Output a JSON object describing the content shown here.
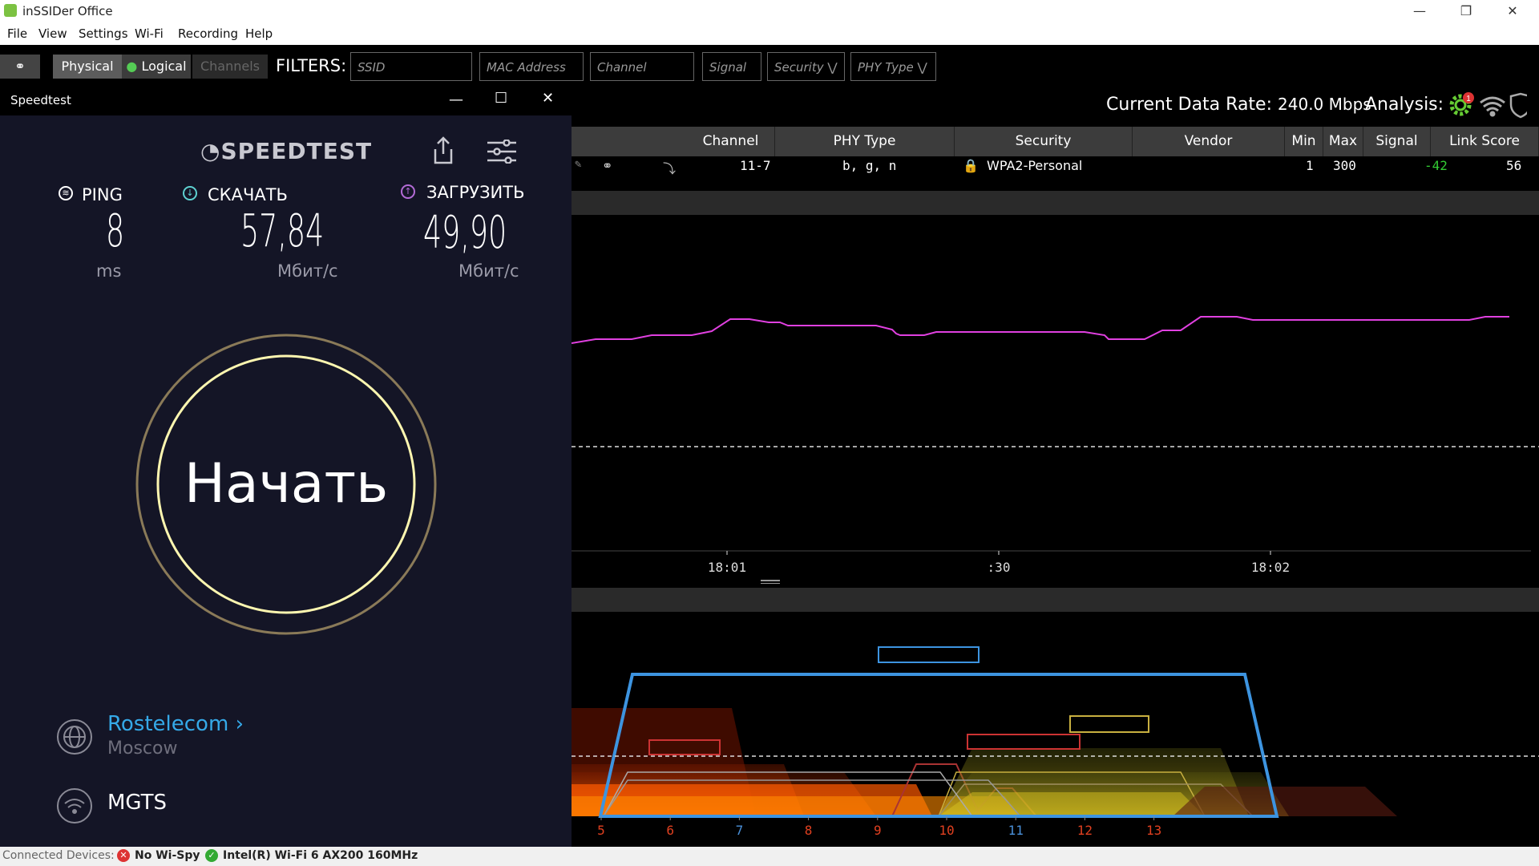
{
  "window": {
    "title": "inSSIDer Office"
  },
  "menu": [
    "File",
    "View",
    "Settings",
    "Wi-Fi",
    "Recording",
    "Help"
  ],
  "toolbar": {
    "physical": "Physical",
    "logical": "Logical",
    "channels": "Channels",
    "filters_label": "FILTERS:",
    "ssid_placeholder": "SSID",
    "mac_placeholder": "MAC Address",
    "channel_placeholder": "Channel",
    "signal_placeholder": "Signal",
    "security_select": "Security",
    "phy_select": "PHY Type"
  },
  "header": {
    "rate_label": "Current Data Rate:",
    "rate_value": "240.0 Mbps",
    "analysis_label": "Analysis:",
    "analysis_badge": "1"
  },
  "table": {
    "columns": [
      "Channel",
      "PHY Type",
      "Security",
      "Vendor",
      "Min",
      "Max",
      "Signal",
      "Link Score"
    ],
    "row": {
      "channel": "11-7",
      "phy": "b, g, n",
      "security": "WPA2-Personal",
      "vendor": "",
      "min": "1",
      "max": "300",
      "signal": "-42",
      "link_score": "56"
    }
  },
  "time_chart": {
    "x_ticks": [
      "18:01",
      ":30",
      "18:02"
    ],
    "line_color": "#e040e0"
  },
  "channel_chart": {
    "channels": [
      "5",
      "6",
      "7",
      "8",
      "9",
      "10",
      "11",
      "12",
      "13"
    ],
    "channel_colors": [
      "#e04020",
      "#e04020",
      "#4a90d9",
      "#e04020",
      "#e04020",
      "#e04020",
      "#4a90d9",
      "#e04020",
      "#e04020"
    ]
  },
  "statusbar": {
    "label": "Connected Devices:",
    "device1": "No Wi-Spy",
    "device2": "Intel(R) Wi-Fi 6 AX200 160MHz"
  },
  "speedtest": {
    "window_title": "Speedtest",
    "logo": "SPEEDTEST",
    "ping_label": "PING",
    "ping_value": "8",
    "ping_unit": "ms",
    "download_label": "СКАЧАТЬ",
    "download_value": "57,84",
    "download_unit": "Мбит/с",
    "upload_label": "ЗАГРУЗИТЬ",
    "upload_value": "49,90",
    "upload_unit": "Мбит/с",
    "start_label": "Начать",
    "provider": "Rostelecom",
    "provider_chevron": "›",
    "location": "Moscow",
    "network": "MGTS"
  }
}
